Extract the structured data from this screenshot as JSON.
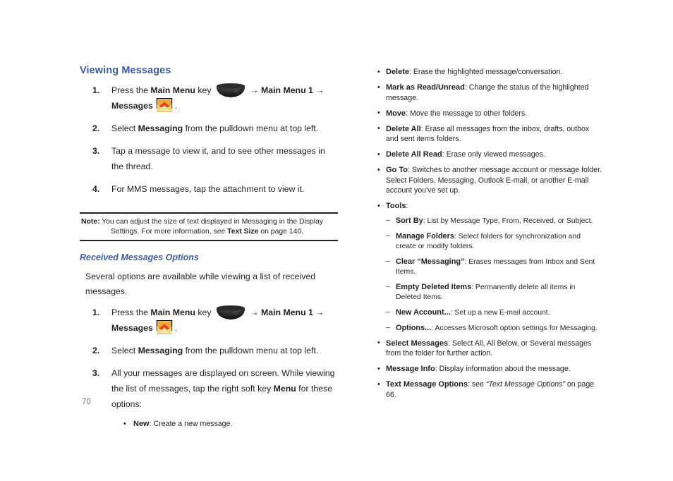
{
  "page": {
    "number": "70",
    "heading_color": "#3d5ca8",
    "text_color": "#231f20",
    "background": "#ffffff"
  },
  "icons": {
    "main_menu_key": "main-menu-key-icon",
    "messages": "messages-envelope-icon",
    "arrow": "→"
  },
  "left": {
    "heading": "Viewing Messages",
    "steps": [
      {
        "num": "1.",
        "pre": "Press the ",
        "bold1": "Main Menu",
        "mid1": " key ",
        "arrow1": "→",
        "bold2": "Main Menu 1",
        "arrow2": "→",
        "bold3": "Messages",
        "tail": "."
      },
      {
        "num": "2.",
        "pre": "Select ",
        "bold1": "Messaging",
        "tail": " from the pulldown menu at top left."
      },
      {
        "num": "3.",
        "text": "Tap a message to view it, and to see other messages in the thread."
      },
      {
        "num": "4.",
        "text": "For MMS messages, tap the attachment to view it."
      }
    ],
    "note": {
      "label": "Note:",
      "part1": " You can adjust the size of text displayed in Messaging in the Display Settings. For more information, see ",
      "bold": "Text Size",
      "part2": " on page 140."
    },
    "subheading": "Received Messages Options",
    "intro": "Several options are available while viewing a list of received messages.",
    "steps2": [
      {
        "num": "1.",
        "pre": "Press the ",
        "bold1": "Main Menu",
        "mid1": " key ",
        "arrow1": "→",
        "bold2": "Main Menu 1",
        "arrow2": "→",
        "bold3": "Messages",
        "tail": "."
      },
      {
        "num": "2.",
        "pre": "Select ",
        "bold1": "Messaging",
        "tail": " from the pulldown menu at top left."
      },
      {
        "num": "3.",
        "pre": "All your messages are displayed on screen. While viewing the list of messages, tap the right soft key ",
        "bold1": "Menu",
        "tail": " for these options:"
      }
    ],
    "substep": {
      "bold": "New",
      "text": ": Create a new message."
    }
  },
  "right": {
    "bullets": [
      {
        "term": "Delete",
        "desc": ": Erase the highlighted message/conversation."
      },
      {
        "term": "Mark as Read/Unread",
        "desc": ": Change the status of the highlighted message."
      },
      {
        "term": "Move",
        "desc": ": Move the message to other folders."
      },
      {
        "term": "Delete All",
        "desc": ": Erase all messages from the inbox, drafts, outbox and sent items folders."
      },
      {
        "term": "Delete All Read",
        "desc": ": Erase only viewed messages."
      },
      {
        "term": "Go To",
        "desc": ": Switches to another message account or message folder. Select Folders, Messaging, Outlook E-mail, or another E-mail account you've set up."
      }
    ],
    "tools": {
      "term": "Tools",
      "desc": ":",
      "items": [
        {
          "term": "Sort By",
          "desc": ": List  by Message Type, From, Received, or  Subject."
        },
        {
          "term": "Manage Folders",
          "desc": ": Select folders for synchronization and create or modify folders."
        },
        {
          "term": "Clear “Messaging”",
          "desc": ": Erases messages from  Inbox and Sent Items."
        },
        {
          "term": "Empty Deleted Items",
          "desc": ": Permanently delete all items in Deleted Items."
        },
        {
          "term": "New Account...",
          "desc": ": Set up a new E-mail account."
        },
        {
          "term": "Options...",
          "desc": ": Accesses Microsoft option settings for Messaging."
        }
      ]
    },
    "bullets_tail": [
      {
        "term": "Select Messages",
        "desc": ": Select All, All Below, or Several messages from the folder for further action."
      },
      {
        "term": "Message Info",
        "desc": ": Display information about the message."
      }
    ],
    "last_bullet": {
      "term": "Text Message Options",
      "pre": ": see ",
      "italic": "“Text Message Options”",
      "tail": " on page 66."
    }
  }
}
